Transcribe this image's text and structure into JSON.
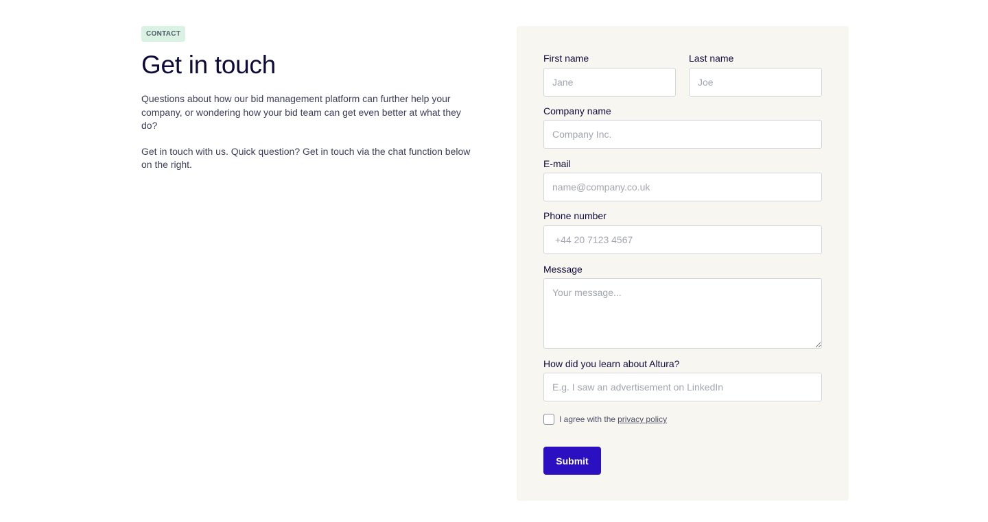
{
  "intro": {
    "badge": "CONTACT",
    "title": "Get in touch",
    "paragraphs": [
      "Questions about how our bid management platform can further help your company, or wondering how your bid team can get even better at what they do?",
      "Get in touch with us. Quick question? Get in touch via the chat function below on the right."
    ]
  },
  "form": {
    "first_name": {
      "label": "First name",
      "placeholder": "Jane"
    },
    "last_name": {
      "label": "Last name",
      "placeholder": "Joe"
    },
    "company": {
      "label": "Company name",
      "placeholder": "Company Inc."
    },
    "email": {
      "label": "E-mail",
      "placeholder": "name@company.co.uk"
    },
    "phone": {
      "label": "Phone number",
      "placeholder": "+44 20 7123 4567"
    },
    "message": {
      "label": "Message",
      "placeholder": "Your message..."
    },
    "source": {
      "label": "How did you learn about Altura?",
      "placeholder": "E.g. I saw an advertisement on LinkedIn"
    },
    "agree_text": "I agree with the",
    "agree_link": "privacy policy",
    "submit_label": "Submit"
  },
  "colors": {
    "accent": "#2a10c0",
    "panel_bg": "#f7f6f1",
    "badge_bg": "#d9f2e3",
    "heading": "#0f0a3c"
  }
}
